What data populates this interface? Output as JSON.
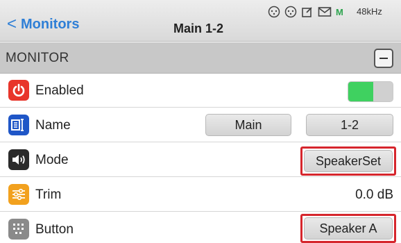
{
  "nav": {
    "back_label": "Monitors",
    "title": "Main 1-2",
    "status_m": "M",
    "sample_rate": "48kHz"
  },
  "section": {
    "label": "MONITOR"
  },
  "rows": {
    "enabled": {
      "label": "Enabled",
      "value_on": true
    },
    "name": {
      "label": "Name",
      "part1": "Main",
      "part2": "1-2"
    },
    "mode": {
      "label": "Mode",
      "value": "SpeakerSet"
    },
    "trim": {
      "label": "Trim",
      "value": "0.0 dB"
    },
    "button": {
      "label": "Button",
      "value": "Speaker A"
    }
  },
  "colors": {
    "accent_link": "#2f7fd6",
    "toggle_on": "#3fd160",
    "highlight_box": "#d6262d",
    "power_icon": "#e8352b",
    "name_icon": "#1f56c7",
    "trim_icon": "#f2a11e"
  },
  "icons": {
    "status": [
      "mic-input-icon",
      "mic-input-icon",
      "edit-icon",
      "mail-icon"
    ],
    "rows": [
      "power-icon",
      "name-tag-icon",
      "speaker-icon",
      "sliders-icon",
      "grid-icon"
    ]
  }
}
